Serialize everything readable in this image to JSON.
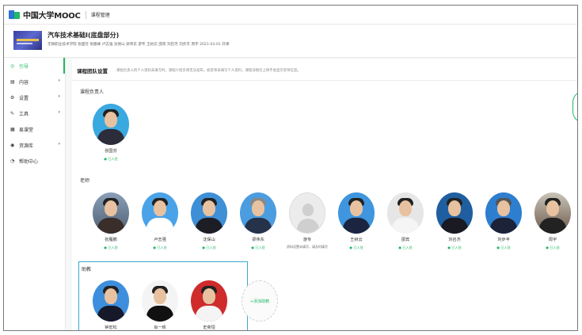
{
  "topbar": {
    "logo_text": "中国大学MOOC",
    "subtitle": "课程管理"
  },
  "course": {
    "title": "汽车技术基础I(底盘部分)",
    "meta": "无锡职业技术学院  张国芬 张雁峰 卢志强 沈保山 梁伟东 游专 王树云 邵宾 刘召杰 刘步丰 周宇  2021-03-01 开课"
  },
  "sidebar": {
    "items": [
      {
        "label": "引导",
        "icon": "◎",
        "active": true
      },
      {
        "label": "内容",
        "icon": "▤",
        "chev": "▾"
      },
      {
        "label": "设置",
        "icon": "⚙",
        "chev": "▾"
      },
      {
        "label": "工具",
        "icon": "✎",
        "chev": "▾"
      },
      {
        "label": "易课堂",
        "icon": "▦"
      },
      {
        "label": "资源库",
        "icon": "◉",
        "chev": "▾"
      },
      {
        "label": "帮助中心",
        "icon": "◔"
      }
    ]
  },
  "main": {
    "section_title": "课程团队设置",
    "section_desc": "课程负责人的个人资料未填写时，课程介绍页将无法发布。如老师未填写个人资料，课程详情页上将不会显示老师信息。",
    "leader_label": "课程负责人",
    "teacher_label": "老师",
    "ta_label": "助教",
    "add_ta_label": "+添加助教",
    "leader": {
      "name": "张国芬",
      "status": "● 已入驻"
    },
    "teachers": [
      {
        "name": "张雁鹏",
        "status": "● 已入驻"
      },
      {
        "name": "卢志强",
        "status": "● 已入驻"
      },
      {
        "name": "沈保山",
        "status": "● 已入驻"
      },
      {
        "name": "梁伟东",
        "status": "● 已入驻"
      },
      {
        "name": "游专",
        "note": "资料设置未填写，请及时填写"
      },
      {
        "name": "王树云",
        "status": "● 已入驻"
      },
      {
        "name": "邵宾",
        "status": "● 已入驻"
      },
      {
        "name": "刘召杰",
        "status": "● 已入驻"
      },
      {
        "name": "刘步丰",
        "status": "● 已入驻"
      },
      {
        "name": "周宇",
        "status": "● 已入驻"
      }
    ],
    "tas": [
      {
        "name": "钟宏松",
        "status": ""
      },
      {
        "name": "肖一帆",
        "status": ""
      },
      {
        "name": "史奕恒",
        "status": ""
      }
    ]
  },
  "colors": {
    "accent_green": "#21b866",
    "brand_blue": "#2a76d2",
    "ta_border": "#38a9c9"
  }
}
